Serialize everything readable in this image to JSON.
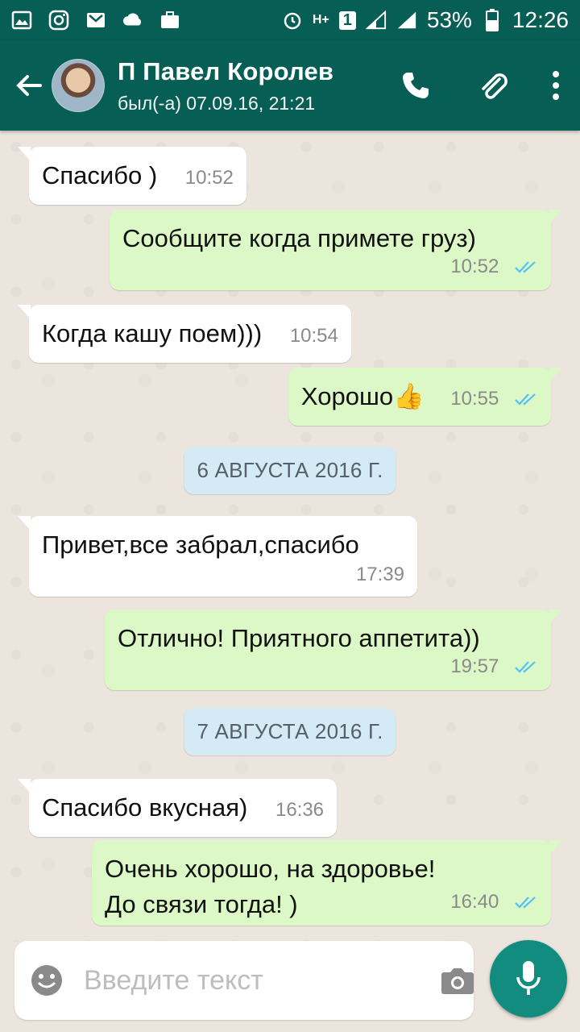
{
  "status_bar": {
    "battery": "53%",
    "time": "12:26",
    "sim_label": "1",
    "network_label": "H+"
  },
  "header": {
    "contact_name": "П Павел Королев",
    "last_seen": "был(-а) 07.09.16, 21:21"
  },
  "messages": [
    {
      "direction": "in",
      "text": "Спасибо )",
      "time": "10:52"
    },
    {
      "direction": "out",
      "text": "Сообщите когда примете груз)",
      "time": "10:52",
      "status": "read"
    },
    {
      "direction": "in",
      "text": "Когда кашу поем)))",
      "time": "10:54"
    },
    {
      "direction": "out",
      "text": "Хорошо👍",
      "time": "10:55",
      "status": "read"
    },
    {
      "type": "date",
      "text": "6 АВГУСТА 2016 Г."
    },
    {
      "direction": "in",
      "text": "Привет,все забрал,спасибо",
      "time": "17:39"
    },
    {
      "direction": "out",
      "text": "Отлично! Приятного аппетита))",
      "time": "19:57",
      "status": "read"
    },
    {
      "type": "date",
      "text": "7 АВГУСТА 2016 Г."
    },
    {
      "direction": "in",
      "text": "Спасибо вкусная)",
      "time": "16:36"
    },
    {
      "direction": "out",
      "text": "Очень хорошо, на здоровье! До связи тогда! )",
      "time": "16:40",
      "status": "read"
    }
  ],
  "input": {
    "placeholder": "Введите текст",
    "value": ""
  },
  "colors": {
    "header_bg": "#075e54",
    "outgoing_bubble": "#dcf8c6",
    "incoming_bubble": "#ffffff",
    "date_chip": "#d4eaf4",
    "mic_button": "#128c7e",
    "read_ticks": "#4fc3f7"
  },
  "icons": {
    "back": "arrow-left-icon",
    "call": "phone-icon",
    "attach": "paperclip-icon",
    "more": "more-vert-icon",
    "emoji": "smiley-icon",
    "camera": "camera-icon",
    "mic": "mic-icon"
  }
}
